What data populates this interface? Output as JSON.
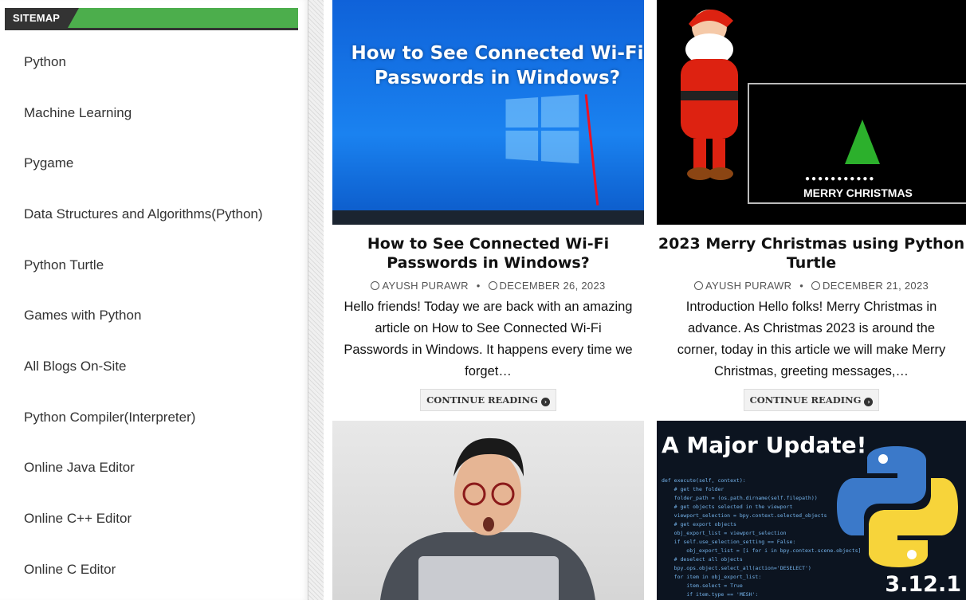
{
  "sidebar": {
    "widget_title": "SITEMAP",
    "items": [
      {
        "label": "Python"
      },
      {
        "label": "Machine Learning"
      },
      {
        "label": "Pygame"
      },
      {
        "label": "Data Structures and Algorithms(Python)"
      },
      {
        "label": "Python Turtle"
      },
      {
        "label": "Games with Python"
      },
      {
        "label": "All Blogs On-Site"
      },
      {
        "label": "Python Compiler(Interpreter)"
      },
      {
        "label": "Online Java Editor"
      },
      {
        "label": "Online C++ Editor"
      },
      {
        "label": "Online C Editor"
      }
    ]
  },
  "posts": [
    {
      "thumb_text": "How to See Connected Wi-Fi Passwords in Windows?",
      "title": "How to See Connected Wi-Fi Passwords in Windows?",
      "author": "AYUSH PURAWR",
      "date": "DECEMBER 26, 2023",
      "excerpt": "Hello friends! Today we are back with an amazing article on How to See Connected Wi-Fi Passwords in Windows. It happens every time we forget…",
      "button": "CONTINUE READING"
    },
    {
      "thumb_text": "MERRY CHRISTMAS",
      "title": "2023 Merry Christmas using Python Turtle",
      "author": "AYUSH PURAWR",
      "date": "DECEMBER 21, 2023",
      "excerpt": "Introduction Hello folks! Merry Christmas in advance. As Christmas 2023 is around the corner, today in this article we will make Merry Christmas, greeting messages,…",
      "button": "CONTINUE READING"
    },
    {
      "thumb_text": ""
    },
    {
      "thumb_text": "A Major Update!",
      "thumb_version": "3.12.1"
    }
  ],
  "colors": {
    "accent": "#4cae4c",
    "dark": "#333333"
  }
}
